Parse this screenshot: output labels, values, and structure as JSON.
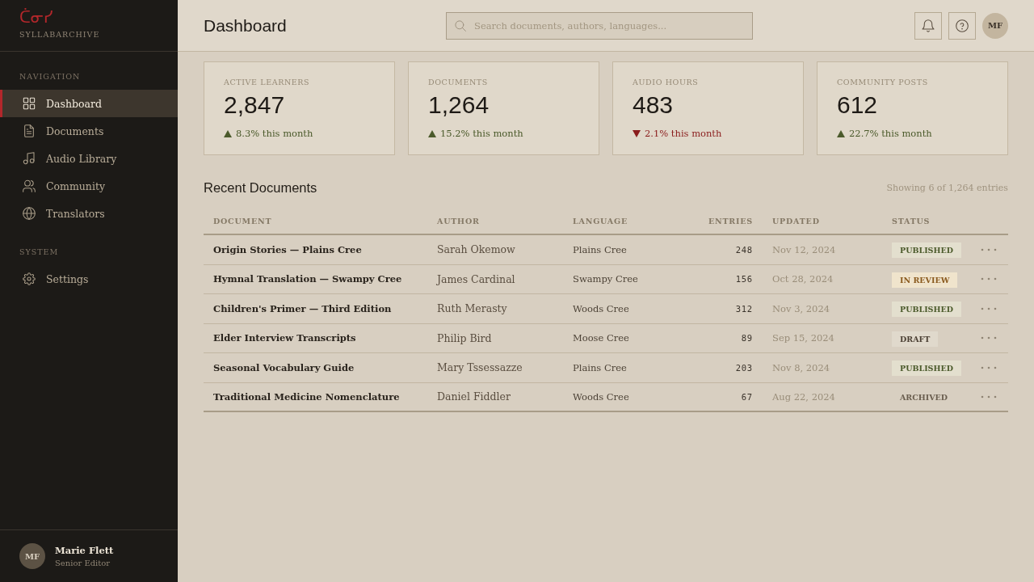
{
  "sidebar": {
    "logo": "ᑖᓂᓯ",
    "brand": "SYLLABARCHIVE",
    "sections": [
      {
        "label": "NAVIGATION",
        "items": [
          {
            "label": "Dashboard",
            "selected": true
          },
          {
            "label": "Documents",
            "selected": false
          },
          {
            "label": "Audio Library",
            "selected": false
          },
          {
            "label": "Community",
            "selected": false
          },
          {
            "label": "Translators",
            "selected": false
          }
        ]
      },
      {
        "label": "SYSTEM",
        "items": [
          {
            "label": "Settings",
            "selected": false
          }
        ]
      }
    ],
    "user": {
      "initials": "MF",
      "name": "Marie Flett",
      "role": "Senior Editor"
    }
  },
  "header": {
    "title": "Dashboard",
    "search": {
      "placeholder": "Search documents, authors, languages..."
    },
    "avatar": "MF"
  },
  "stats": [
    {
      "label": "ACTIVE LEARNERS",
      "value": "2,847",
      "kind": "increase",
      "change": "8.3% this month"
    },
    {
      "label": "DOCUMENTS",
      "value": "1,264",
      "kind": "increase",
      "change": "15.2% this month"
    },
    {
      "label": "AUDIO HOURS",
      "value": "483",
      "kind": "decrease",
      "change": "2.1% this month"
    },
    {
      "label": "COMMUNITY POSTS",
      "value": "612",
      "kind": "increase",
      "change": "22.7% this month"
    }
  ],
  "recent_documents": {
    "title": "Recent Documents",
    "summary": "Showing 6 of 1,264 entries",
    "columns": [
      "DOCUMENT",
      "AUTHOR",
      "LANGUAGE",
      "ENTRIES",
      "UPDATED",
      "STATUS"
    ],
    "rows": [
      {
        "document": "Origin Stories — Plains Cree",
        "author": "Sarah Okemow",
        "language": "Plains Cree",
        "entries": "248",
        "updated": "Nov 12, 2024",
        "status": {
          "label": "PUBLISHED",
          "kind": "published"
        }
      },
      {
        "document": "Hymnal Translation — Swampy Cree",
        "author": "James Cardinal",
        "language": "Swampy Cree",
        "entries": "156",
        "updated": "Oct 28, 2024",
        "status": {
          "label": "IN REVIEW",
          "kind": "review"
        }
      },
      {
        "document": "Children's Primer — Third Edition",
        "author": "Ruth Merasty",
        "language": "Woods Cree",
        "entries": "312",
        "updated": "Nov 3, 2024",
        "status": {
          "label": "PUBLISHED",
          "kind": "published"
        }
      },
      {
        "document": "Elder Interview Transcripts",
        "author": "Philip Bird",
        "language": "Moose Cree",
        "entries": "89",
        "updated": "Sep 15, 2024",
        "status": {
          "label": "DRAFT",
          "kind": "draft"
        }
      },
      {
        "document": "Seasonal Vocabulary Guide",
        "author": "Mary Tssessazze",
        "language": "Plains Cree",
        "entries": "203",
        "updated": "Nov 8, 2024",
        "status": {
          "label": "PUBLISHED",
          "kind": "published"
        }
      },
      {
        "document": "Traditional Medicine Nomenclature",
        "author": "Daniel Fiddler",
        "language": "Woods Cree",
        "entries": "67",
        "updated": "Aug 22, 2024",
        "status": {
          "label": "ARCHIVED",
          "kind": "archived"
        }
      }
    ]
  }
}
